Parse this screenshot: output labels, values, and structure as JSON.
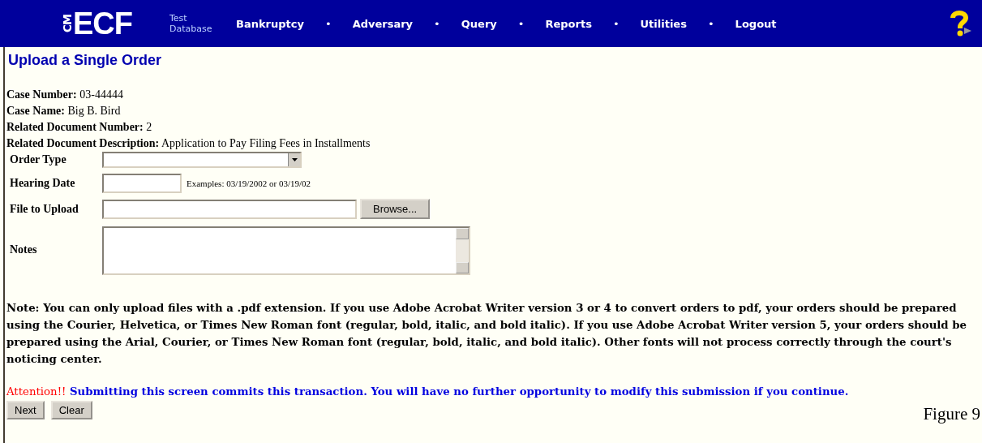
{
  "nav": {
    "logo_side": "CM",
    "logo": "ECF",
    "database_label": "Test Database",
    "items": [
      {
        "kind": "link",
        "label": "Bankruptcy"
      },
      {
        "kind": "separator",
        "label": "•"
      },
      {
        "kind": "link",
        "label": "Adversary"
      },
      {
        "kind": "separator",
        "label": "•"
      },
      {
        "kind": "link",
        "label": "Query"
      },
      {
        "kind": "separator",
        "label": "•"
      },
      {
        "kind": "link",
        "label": "Reports"
      },
      {
        "kind": "separator",
        "label": "•"
      },
      {
        "kind": "link",
        "label": "Utilities"
      },
      {
        "kind": "separator",
        "label": "•"
      },
      {
        "kind": "link",
        "label": "Logout"
      }
    ]
  },
  "page_title": "Upload a Single Order",
  "case_info": [
    {
      "label": "Case Number:",
      "value": "03-44444"
    },
    {
      "label": "Case Name:",
      "value": "Big B. Bird"
    },
    {
      "label": "Related Document Number:",
      "value": "2"
    },
    {
      "label": "Related Document Description:",
      "value": "Application to Pay Filing Fees in Installments"
    }
  ],
  "form": [
    {
      "kind": "select",
      "label": "Order Type"
    },
    {
      "kind": "date",
      "label": "Hearing Date",
      "hint": "Examples: 03/19/2002 or 03/19/02"
    },
    {
      "kind": "file",
      "label": "File to Upload",
      "button": "Browse..."
    },
    {
      "kind": "textarea",
      "label": "Notes"
    }
  ],
  "note": "Note: You can only upload files with a .pdf extension. If you use Adobe Acrobat Writer version 3 or 4 to convert orders to pdf, your orders should be prepared using the Courier, Helvetica, or Times New Roman font (regular, bold, italic, and bold italic). If you use Adobe Acrobat Writer version 5, your orders should be prepared using the Arial, Courier, or Times New Roman font (regular, bold, italic, and bold italic). Other fonts will not process correctly through the court's noticing center.",
  "attention": {
    "label": "Attention!!",
    "message": "Submitting this screen commits this transaction. You will have no further opportunity to modify this submission if you continue."
  },
  "buttons": [
    "Next",
    "Clear"
  ],
  "caption": "Figure 9"
}
